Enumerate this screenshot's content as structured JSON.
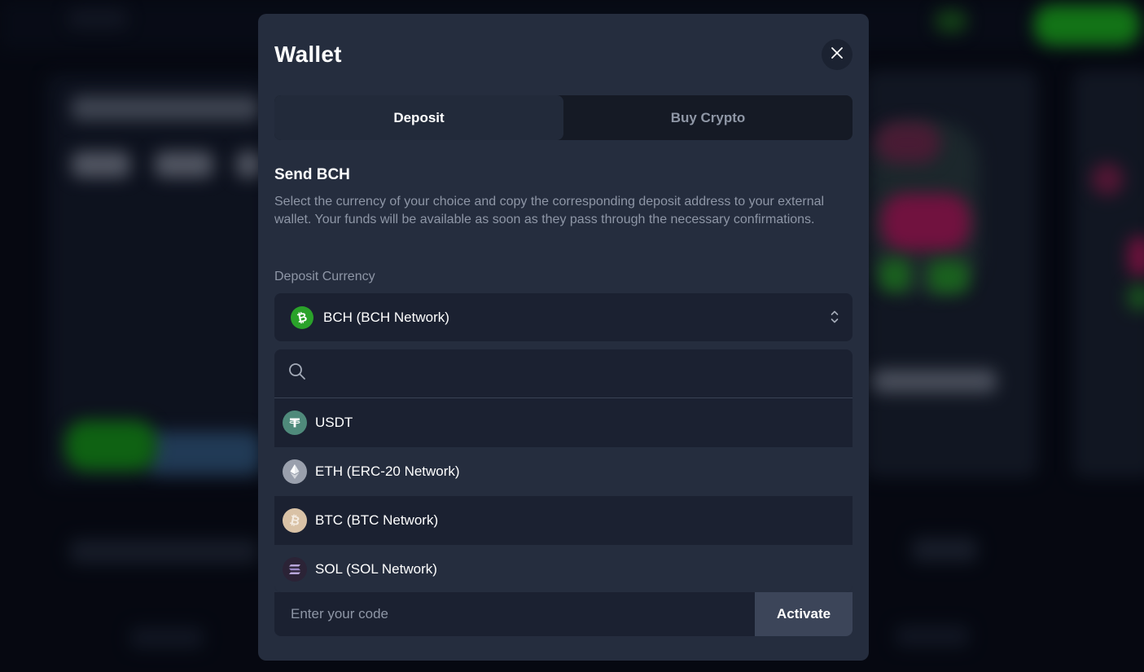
{
  "modal": {
    "title": "Wallet",
    "tabs": [
      {
        "label": "Deposit",
        "active": true
      },
      {
        "label": "Buy Crypto",
        "active": false
      }
    ],
    "section_title": "Send BCH",
    "description": "Select the currency of your choice and copy the corresponding deposit address to your external wallet. Your funds will be available as soon as they pass through the necessary confirmations.",
    "currency_label": "Deposit Currency",
    "selected_currency": {
      "label": "BCH (BCH Network)",
      "icon": "bch-icon",
      "color": "#2aa22a"
    },
    "search": {
      "value": "",
      "placeholder": ""
    },
    "options": [
      {
        "label": "USDT",
        "icon": "usdt-icon",
        "color": "#4f8a7b"
      },
      {
        "label": "ETH (ERC-20 Network)",
        "icon": "eth-icon",
        "color": "#9aa0ad"
      },
      {
        "label": "BTC (BTC Network)",
        "icon": "btc-icon",
        "color": "#d9c2a6"
      },
      {
        "label": "SOL (SOL Network)",
        "icon": "sol-icon",
        "color": "#2b2336"
      }
    ],
    "code": {
      "value": "",
      "placeholder": "Enter your code"
    },
    "activate_label": "Activate"
  },
  "colors": {
    "modal_bg": "#252d3e",
    "field_bg": "#1b2131",
    "activate_bg": "#3c4559",
    "muted_text": "#8e96a6"
  }
}
